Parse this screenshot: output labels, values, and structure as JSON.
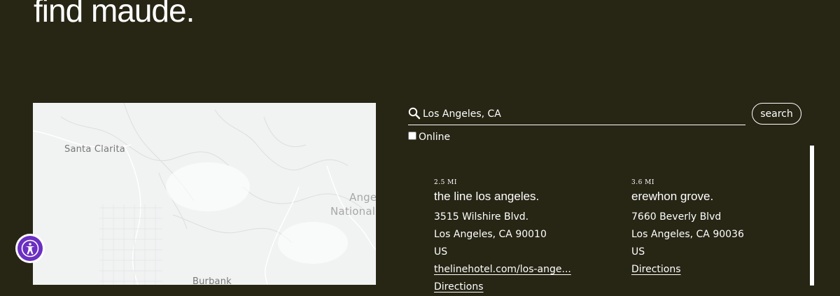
{
  "hero": {
    "title": "find maude."
  },
  "map": {
    "labels": {
      "santa_clarita": "Santa Clarita",
      "angeles_1": "Ange",
      "angeles_2": "National",
      "burbank": "Burbank"
    }
  },
  "accessibility": {
    "icon": "accessibility-icon"
  },
  "search": {
    "value": "Los Angeles, CA",
    "button_label": "search",
    "online_label": "Online",
    "online_checked": false
  },
  "results": [
    {
      "distance": "2.5 MI",
      "name": "the line los angeles.",
      "address1": "3515 Wilshire Blvd.",
      "address2": "Los Angeles, CA 90010",
      "country": "US",
      "website": "thelinehotel.com/los-ange...",
      "directions": "Directions"
    },
    {
      "distance": "3.6 MI",
      "name": "erewhon grove.",
      "address1": "7660 Beverly Blvd",
      "address2": "Los Angeles, CA 90036",
      "country": "US",
      "directions": "Directions"
    }
  ]
}
